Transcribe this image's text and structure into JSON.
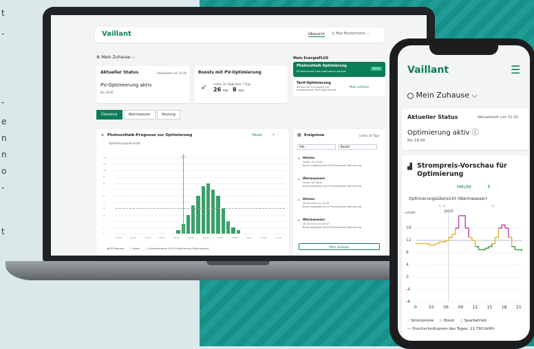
{
  "side_text": [
    "t",
    "-",
    "-",
    "e",
    "n",
    "n",
    "o",
    "-",
    "t"
  ],
  "laptop": {
    "brand": "Vaillant",
    "nav_overview": "Übersicht",
    "nav_account": "Max Mustermann",
    "home": "Mein Zuhause",
    "status_card": {
      "title": "Aktueller Status",
      "updated": "Aktualisiert um 10:30",
      "value": "PV-Optimierung aktiv",
      "until": "Bis 18:00"
    },
    "boosts_card": {
      "title": "Boosts mit PV-Optimierung",
      "label1": "Letzte 30 Tage",
      "label2": "Letzte 7 Tage",
      "value1": "26",
      "unit1": "mal",
      "value2": "8",
      "unit2": "mal"
    },
    "energie": {
      "title": "Mein EnergiePLUS",
      "pv_title": "Photovoltaik Optimierung",
      "pv_sub": "PV-Überschuss wird automatisch genutzt",
      "pv_badge": "AKTIV",
      "tarif_title": "Tarif-Optimierung",
      "tarif_sub": "Senken Sie Ihre Kosten mit automatischer Tarif-Optimierung",
      "tarif_link": "Mehr erfahren"
    },
    "tabs": [
      "Überblick",
      "Warmwasser",
      "Heizung"
    ],
    "forecast": {
      "title": "Photovoltaik-Prognose zur Optimierung",
      "today": "Heute",
      "sub": "Optimierungsübersicht",
      "now": "Jetzt",
      "y_ticks": [
        "12",
        "11",
        "10",
        "9",
        "8",
        "7",
        "6",
        "5",
        "4",
        "3",
        "2",
        "1",
        "0"
      ],
      "x_ticks": [
        "00:00",
        "02:00",
        "04:00",
        "06:00",
        "08:00",
        "10:00",
        "12:00",
        "14:00",
        "16:00",
        "18:00",
        "20:00",
        "22:00"
      ],
      "legend": [
        "PV-Prognose",
        "Boost",
        "Schwellenwerte für PV-Optimierung (Warmwasser)"
      ]
    },
    "events": {
      "title": "Ereignisse",
      "range": "Letzte 30 Tage",
      "filter1": "Alle",
      "filter2": "Boosts",
      "more": "Mehr anzeigen",
      "items": [
        {
          "title": "Heizen",
          "time": "Heute um 09:00",
          "desc": "Boost ausgelöst durch Photovoltaik-Optimierung"
        },
        {
          "title": "Warmwasser",
          "time": "Heute um 08:00",
          "desc": "Boost ausgelöst durch Photovoltaik-Optimierung"
        },
        {
          "title": "Heizen",
          "time": "28.03.2025 um 12:00",
          "desc": "Boost ausgelöst durch Photovoltaik-Optimierung"
        },
        {
          "title": "Warmwasser",
          "time": "28.03.2025 um 10:00",
          "desc": "Boost ausgelöst durch Photovoltaik-Optimierung"
        }
      ]
    }
  },
  "phone": {
    "brand": "Vaillant",
    "home": "Mein Zuhause",
    "status": {
      "title": "Aktueller Status",
      "updated": "Aktualisiert um 11:25",
      "value": "Optimierung aktiv",
      "until": "Bis 18:00"
    },
    "chart": {
      "title": "Strompreis-Vorschau für Optimierung",
      "today": "Heute",
      "sub": "Optimierungsübersicht (Warmwasser)",
      "now": "Jetzt",
      "unit": "ct/kWh",
      "legend1": "Strompreise",
      "legend2": "Boost",
      "legend3": "Sparbetrieb",
      "legend4": "Durchschnittspreis des Tages: 11.79Ct/kWh"
    }
  },
  "chart_data": [
    {
      "type": "bar",
      "title": "Photovoltaik-Prognose zur Optimierung",
      "categories": [
        "00:00",
        "02:00",
        "04:00",
        "06:00",
        "08:00",
        "10:00",
        "12:00",
        "14:00",
        "16:00",
        "18:00",
        "20:00",
        "22:00"
      ],
      "values_hourly": [
        0,
        0,
        0,
        0,
        0,
        0,
        0,
        0,
        0,
        0,
        0,
        0,
        0.5,
        1.5,
        3,
        4.5,
        6,
        7.5,
        8,
        7,
        6,
        4,
        2,
        1,
        0.5,
        0,
        0,
        0,
        0,
        0,
        0,
        0,
        0
      ],
      "ylim": [
        0,
        12
      ]
    },
    {
      "type": "line",
      "title": "Strompreis-Vorschau für Optimierung",
      "x_ticks": [
        "0",
        "03",
        "06",
        "09",
        "12",
        "15",
        "18",
        "21"
      ],
      "y_ticks": [
        "-8",
        "-4",
        "0",
        "4",
        "8",
        "12",
        "16"
      ],
      "ylabel": "ct/kWh",
      "ylim": [
        -8,
        20
      ],
      "y": [
        11,
        11,
        11,
        11,
        10.5,
        10.5,
        11,
        11.5,
        11.5,
        12,
        13,
        14,
        16,
        20,
        20,
        16,
        13,
        12,
        10,
        9,
        9,
        9.5,
        10,
        11,
        13,
        16,
        17,
        16,
        13,
        10,
        9,
        9,
        8.5
      ]
    }
  ]
}
